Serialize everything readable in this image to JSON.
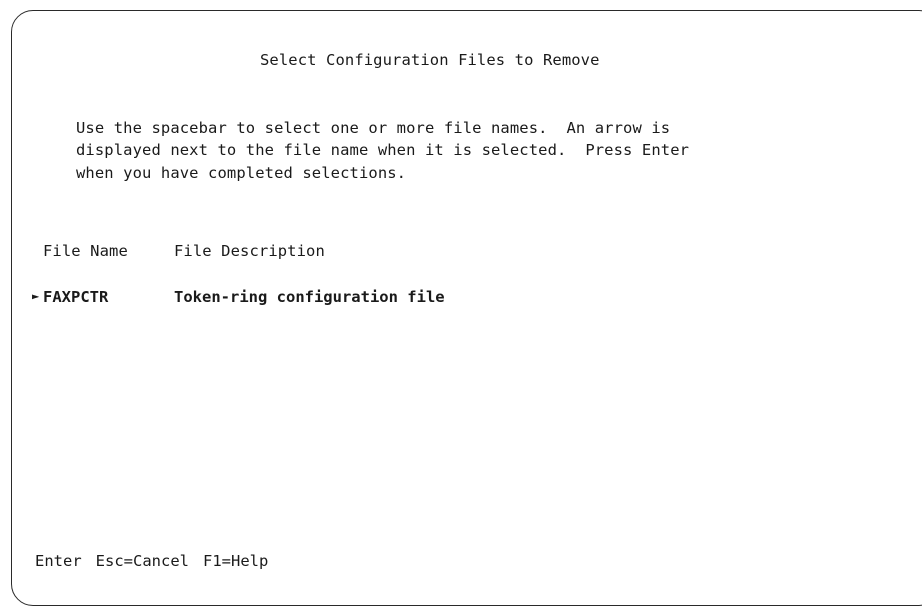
{
  "screen": {
    "title": "Select Configuration Files to Remove",
    "instructions": [
      "Use the spacebar to select one or more file names.  An arrow is",
      "displayed next to the file name when it is selected.  Press Enter",
      "when you have completed selections."
    ]
  },
  "table": {
    "headers": {
      "name": "File Name",
      "description": "File Description"
    },
    "rows": [
      {
        "selected_marker": "►",
        "name": "FAXPCTR",
        "description": "Token-ring configuration file"
      }
    ]
  },
  "function_keys": [
    "Enter",
    "Esc=Cancel",
    "F1=Help"
  ]
}
